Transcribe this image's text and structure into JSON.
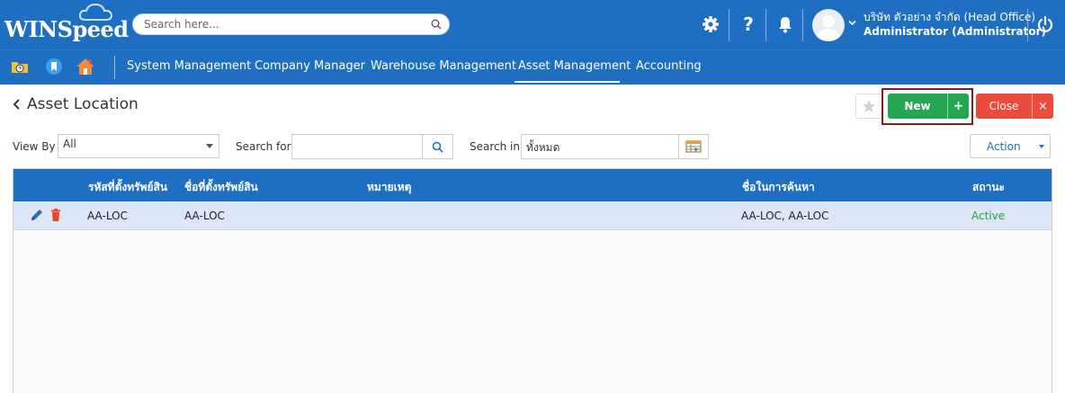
{
  "app": {
    "logo": "WINSpeed"
  },
  "header": {
    "search_placeholder": "Search here...",
    "icons": [
      "gear-icon",
      "help-icon",
      "bell-icon",
      "user-avatar",
      "power-icon"
    ],
    "help_glyph": "?",
    "user": {
      "company": "บริษัท ตัวอย่าง จำกัด (Head Office)",
      "name": "Administrator (Administrator)"
    }
  },
  "nav": {
    "quick_icons": [
      "folder-clock-icon",
      "bookmark-icon",
      "home-icon"
    ],
    "items": [
      {
        "label": "System Management"
      },
      {
        "label": "Company Manager"
      },
      {
        "label": "Warehouse Management"
      },
      {
        "label": "Asset Management",
        "active": true
      },
      {
        "label": "Accounting"
      }
    ]
  },
  "page": {
    "title": "Asset Location",
    "new_label": "New",
    "new_plus": "+",
    "close_label": "Close",
    "close_x": "×"
  },
  "filters": {
    "view_by_label": "View By",
    "view_by_value": "All",
    "search_for_label": "Search for",
    "search_for_value": "",
    "search_in_label": "Search in",
    "search_in_value": "ทั้งหมด",
    "action_label": "Action"
  },
  "table": {
    "columns": [
      "รหัสที่ตั้งทรัพย์สิน",
      "ชื่อที่ตั้งทรัพย์สิน",
      "หมายเหตุ",
      "ชื่อในการค้นหา",
      "สถานะ"
    ],
    "rows": [
      {
        "code": "AA-LOC",
        "name": "AA-LOC",
        "remark": "",
        "search_name": "AA-LOC, AA-LOC",
        "status": "Active"
      }
    ]
  },
  "colors": {
    "primary": "#1e6fc2",
    "new_button": "#26a653",
    "close_button": "#e74c3c",
    "row_selected": "#dce6f5",
    "status_active": "#2e9b4b",
    "highlight_box": "#8b1a1a"
  }
}
